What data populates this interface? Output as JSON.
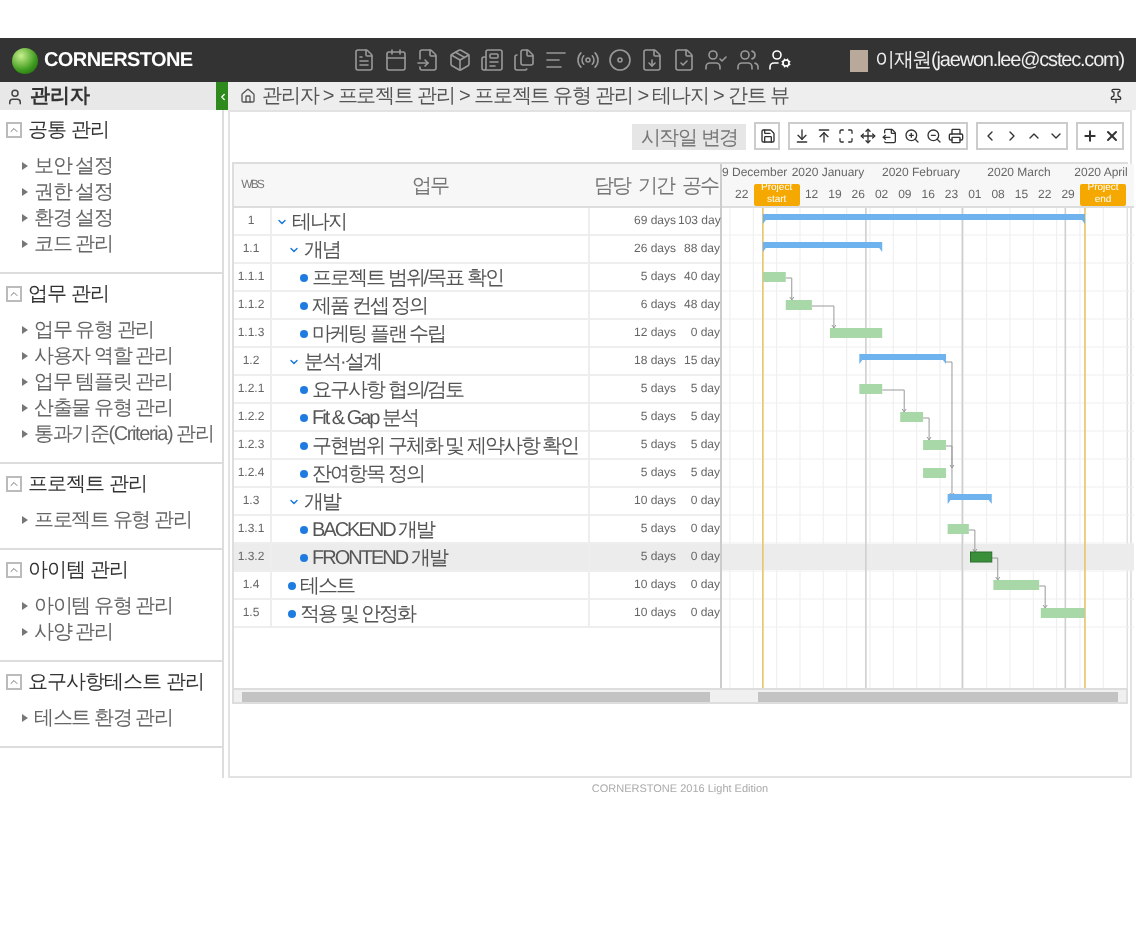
{
  "header": {
    "logo": "CORNERSTONE",
    "user": "이재원(jaewon.lee@cstec.com)"
  },
  "sidebar": {
    "title": "관리자",
    "sections": [
      {
        "title": "공통 관리",
        "expanded": true,
        "items": [
          "보안 설정",
          "권한 설정",
          "환경 설정",
          "코드 관리"
        ]
      },
      {
        "title": "업무 관리",
        "expanded": true,
        "items": [
          "업무 유형 관리",
          "사용자 역할 관리",
          "업무 템플릿 관리",
          "산출물 유형 관리",
          "통과기준(Criteria) 관리"
        ]
      },
      {
        "title": "프로젝트 관리",
        "expanded": true,
        "items": [
          "프로젝트 유형 관리"
        ]
      },
      {
        "title": "아이템 관리",
        "expanded": true,
        "items": [
          "아이템 유형 관리",
          "사양 관리"
        ]
      },
      {
        "title": "요구사항테스트 관리",
        "expanded": true,
        "items": [
          "테스트 환경 관리"
        ]
      }
    ]
  },
  "breadcrumb": "관리자 > 프로젝트 관리 > 프로젝트 유형 관리 > 테나지 > 간트 뷰",
  "toolbar": {
    "start_date_button": "시작일 변경"
  },
  "grid": {
    "columns": [
      "WBS",
      "업무",
      "담당",
      "기간",
      "공수"
    ],
    "rows": [
      {
        "wbs": "1",
        "task": "테나지",
        "duration": "69 days",
        "effort": "103 day",
        "expanded": true,
        "selected": false,
        "children": [
          {
            "wbs": "1.1",
            "task": "개념",
            "duration": "26 days",
            "effort": "88 day",
            "expanded": true,
            "selected": false,
            "children": [
              {
                "wbs": "1.1.1",
                "task": "프로젝트 범위/목표 확인",
                "duration": "5 days",
                "effort": "40 day",
                "selected": false
              },
              {
                "wbs": "1.1.2",
                "task": "제품 컨셉 정의",
                "duration": "6 days",
                "effort": "48 day",
                "selected": false
              },
              {
                "wbs": "1.1.3",
                "task": "마케팅 플랜 수립",
                "duration": "12 days",
                "effort": "0 day",
                "selected": false
              }
            ]
          },
          {
            "wbs": "1.2",
            "task": "분석·설계",
            "duration": "18 days",
            "effort": "15 day",
            "expanded": true,
            "selected": false,
            "children": [
              {
                "wbs": "1.2.1",
                "task": "요구사항 협의/검토",
                "duration": "5 days",
                "effort": "5 day",
                "selected": false
              },
              {
                "wbs": "1.2.2",
                "task": "Fit & Gap 분석",
                "duration": "5 days",
                "effort": "5 day",
                "selected": false
              },
              {
                "wbs": "1.2.3",
                "task": "구현범위 구체화 및 제약사항 확인",
                "duration": "5 days",
                "effort": "5 day",
                "selected": false
              },
              {
                "wbs": "1.2.4",
                "task": "잔여항목 정의",
                "duration": "5 days",
                "effort": "5 day",
                "selected": false
              }
            ]
          },
          {
            "wbs": "1.3",
            "task": "개발",
            "duration": "10 days",
            "effort": "0 day",
            "expanded": true,
            "selected": false,
            "children": [
              {
                "wbs": "1.3.1",
                "task": "BACKEND 개발",
                "duration": "5 days",
                "effort": "0 day",
                "selected": false
              },
              {
                "wbs": "1.3.2",
                "task": "FRONTEND 개발",
                "duration": "5 days",
                "effort": "0 day",
                "selected": true
              }
            ]
          },
          {
            "wbs": "1.4",
            "task": "테스트",
            "duration": "10 days",
            "effort": "0 day",
            "selected": false
          },
          {
            "wbs": "1.5",
            "task": "적용 및 안정화",
            "duration": "10 days",
            "effort": "0 day",
            "selected": false
          }
        ]
      }
    ]
  },
  "timeline": {
    "months": [
      "9 December",
      "2020 January",
      "2020 February",
      "2020 March",
      "2020 April"
    ],
    "scale": [
      {
        "kind": "day",
        "text": "22"
      },
      {
        "kind": "marker",
        "text": "Project start"
      },
      {
        "kind": "day",
        "text": "12"
      },
      {
        "kind": "day",
        "text": "19"
      },
      {
        "kind": "day",
        "text": "26"
      },
      {
        "kind": "day",
        "text": "02"
      },
      {
        "kind": "day",
        "text": "09"
      },
      {
        "kind": "day",
        "text": "16"
      },
      {
        "kind": "day",
        "text": "23"
      },
      {
        "kind": "day",
        "text": "01"
      },
      {
        "kind": "day",
        "text": "08"
      },
      {
        "kind": "day",
        "text": "15"
      },
      {
        "kind": "day",
        "text": "22"
      },
      {
        "kind": "day",
        "text": "29"
      },
      {
        "kind": "marker",
        "text": "Project end"
      }
    ]
  },
  "footer": "CORNERSTONE 2016 Light Edition"
}
